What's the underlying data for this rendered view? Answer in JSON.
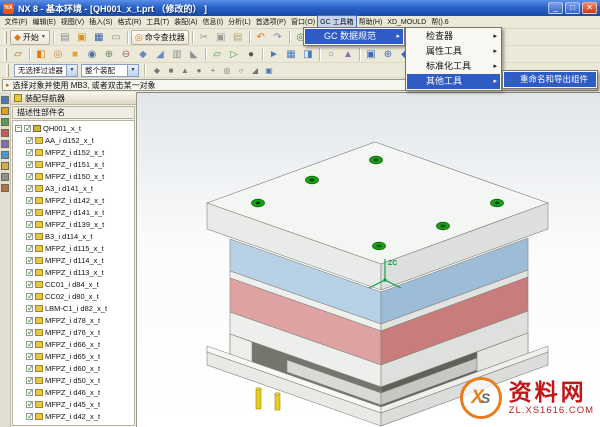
{
  "window": {
    "title": "NX 8 - 基本环境 - [QH001_x_t.prt （修改的） ]",
    "min": "_",
    "max": "□",
    "close": "✕"
  },
  "menubar": {
    "items": [
      {
        "name": "menu-file",
        "label": "文件(F)"
      },
      {
        "name": "menu-edit",
        "label": "编辑(E)"
      },
      {
        "name": "menu-view",
        "label": "视图(V)"
      },
      {
        "name": "menu-insert",
        "label": "插入(S)"
      },
      {
        "name": "menu-format",
        "label": "格式(R)"
      },
      {
        "name": "menu-tools",
        "label": "工具(T)"
      },
      {
        "name": "menu-assemblies",
        "label": "装配(A)"
      },
      {
        "name": "menu-information",
        "label": "信息(I)"
      },
      {
        "name": "menu-analysis",
        "label": "分析(L)"
      },
      {
        "name": "menu-preferences",
        "label": "首选项(P)"
      },
      {
        "name": "menu-window",
        "label": "窗口(O)"
      },
      {
        "name": "menu-gc-toolbox",
        "label": "GC 工具箱",
        "active": true
      },
      {
        "name": "menu-help",
        "label": "帮助(H)"
      },
      {
        "name": "menu-xd-mould",
        "label": "XD_MOULD"
      },
      {
        "name": "menu-help-2",
        "label": "帮().6"
      }
    ]
  },
  "toolbar1": {
    "start_label": "开始",
    "finder_label": "命令查找器",
    "items": [
      {
        "t": "handle"
      },
      {
        "t": "start"
      },
      {
        "t": "sep"
      },
      {
        "t": "icon",
        "name": "new-file-icon",
        "g": "▤",
        "c": "#8a8a8a"
      },
      {
        "t": "icon",
        "name": "open-folder-icon",
        "g": "▣",
        "c": "#d89020"
      },
      {
        "t": "icon",
        "name": "save-icon",
        "g": "▦",
        "c": "#3a5fa8"
      },
      {
        "t": "icon",
        "name": "print-icon",
        "g": "▭",
        "c": "#909090"
      },
      {
        "t": "sep"
      },
      {
        "t": "finder"
      },
      {
        "t": "sep"
      },
      {
        "t": "icon",
        "name": "cut-icon",
        "g": "✂",
        "c": "#9a9a9a"
      },
      {
        "t": "icon",
        "name": "copy-icon",
        "g": "▣",
        "c": "#9a9a9a"
      },
      {
        "t": "icon",
        "name": "paste-icon",
        "g": "▤",
        "c": "#b0a878"
      },
      {
        "t": "sep"
      },
      {
        "t": "icon",
        "name": "undo-icon",
        "g": "↶",
        "c": "#e07818"
      },
      {
        "t": "icon",
        "name": "redo-icon",
        "g": "↷",
        "c": "#7a8ab0"
      },
      {
        "t": "sep"
      },
      {
        "t": "icon",
        "name": "refresh-view-icon",
        "g": "◎",
        "c": "#4a8a4a"
      },
      {
        "t": "icon",
        "name": "fit-view-icon",
        "g": "▣",
        "c": "#4a7ac0"
      },
      {
        "t": "icon",
        "name": "orient-view-cube-icon",
        "g": "◧",
        "c": "#e07818"
      },
      {
        "t": "icon",
        "name": "shaded-view-icon",
        "g": "◨",
        "c": "#4a7ac0"
      },
      {
        "t": "icon",
        "name": "sphere-tool-icon",
        "g": "●",
        "c": "#b8c4d8"
      },
      {
        "t": "sep"
      },
      {
        "t": "icon",
        "name": "window-icon",
        "g": "▭",
        "c": "#5a7ab0"
      },
      {
        "t": "icon",
        "name": "pan-view-icon",
        "g": "+",
        "c": "#3a6ac0"
      },
      {
        "t": "icon",
        "name": "zoom-view-icon",
        "g": "○",
        "c": "#3a6ac0"
      },
      {
        "t": "icon",
        "name": "rotate-view-icon",
        "g": "◎",
        "c": "#3a6ac0"
      },
      {
        "t": "icon",
        "name": "front-view-icon",
        "g": "◇",
        "c": "#7a8a9a"
      },
      {
        "t": "icon",
        "name": "isometric-view-icon",
        "g": "◆",
        "c": "#7a8a9a"
      },
      {
        "t": "sep"
      },
      {
        "t": "icon",
        "name": "help-icon",
        "g": "?",
        "c": "#2a5ac8"
      }
    ]
  },
  "toolbar2": {
    "items": [
      {
        "t": "handle"
      },
      {
        "t": "icon",
        "name": "sketch-icon",
        "g": "▱",
        "c": "#b06820"
      },
      {
        "t": "sep"
      },
      {
        "t": "icon",
        "name": "extrude-icon",
        "g": "◧",
        "c": "#e07818"
      },
      {
        "t": "icon",
        "name": "revolve-icon",
        "g": "◎",
        "c": "#d08030"
      },
      {
        "t": "icon",
        "name": "block-icon",
        "g": "■",
        "c": "#e8a030"
      },
      {
        "t": "icon",
        "name": "hole-icon",
        "g": "◉",
        "c": "#4a6fa5"
      },
      {
        "t": "icon",
        "name": "unite-icon",
        "g": "⊕",
        "c": "#5a8a5a"
      },
      {
        "t": "icon",
        "name": "subtract-icon",
        "g": "⊖",
        "c": "#a05a5a"
      },
      {
        "t": "icon",
        "name": "edge-blend-icon",
        "g": "◆",
        "c": "#6a8ac0"
      },
      {
        "t": "icon",
        "name": "chamfer-icon",
        "g": "◢",
        "c": "#6a8ac0"
      },
      {
        "t": "icon",
        "name": "shell-icon",
        "g": "▥",
        "c": "#909090"
      },
      {
        "t": "icon",
        "name": "draft-icon",
        "g": "◣",
        "c": "#909090"
      },
      {
        "t": "sep"
      },
      {
        "t": "icon",
        "name": "datum-plane-icon",
        "g": "▱",
        "c": "#5a9a50"
      },
      {
        "t": "icon",
        "name": "datum-axis-icon",
        "g": "▷",
        "c": "#5a9a50"
      },
      {
        "t": "icon",
        "name": "point-icon",
        "g": "●",
        "c": "#555555"
      },
      {
        "t": "sep"
      },
      {
        "t": "icon",
        "name": "move-face-icon",
        "g": "►",
        "c": "#4a7ac0"
      },
      {
        "t": "icon",
        "name": "pattern-feature-icon",
        "g": "▦",
        "c": "#4a7ac0"
      },
      {
        "t": "icon",
        "name": "mirror-feature-icon",
        "g": "◨",
        "c": "#4a7ac0"
      },
      {
        "t": "sep"
      },
      {
        "t": "icon",
        "name": "measure-icon",
        "g": "○",
        "c": "#8a6ab0"
      },
      {
        "t": "icon",
        "name": "analysis-icon",
        "g": "▲",
        "c": "#8a6ab0"
      },
      {
        "t": "sep"
      },
      {
        "t": "icon",
        "name": "assembly-constraints-icon",
        "g": "▣",
        "c": "#3a6ac0"
      },
      {
        "t": "icon",
        "name": "add-component-icon",
        "g": "⊕",
        "c": "#3a6ac0"
      },
      {
        "t": "icon",
        "name": "move-component-icon",
        "g": "◆",
        "c": "#3a6ac0"
      },
      {
        "t": "icon",
        "name": "wave-link-icon",
        "g": "▨",
        "c": "#7a8a9a"
      },
      {
        "t": "icon",
        "name": "edit-section-icon",
        "g": "◩",
        "c": "#7a8a9a"
      },
      {
        "t": "sep"
      },
      {
        "t": "icon",
        "name": "layer-settings-icon",
        "g": "▤",
        "c": "#888888"
      },
      {
        "t": "icon",
        "name": "preferences-icon",
        "g": "▩",
        "c": "#888888"
      }
    ]
  },
  "selection_bar": {
    "filter_value": "无选择过滤器",
    "scope_value": "整个装配",
    "icons": [
      {
        "name": "snap-point-icon",
        "g": "◆",
        "c": "#777777"
      },
      {
        "name": "end-point-icon",
        "g": "■",
        "c": "#777777"
      },
      {
        "name": "mid-point-icon",
        "g": "▲",
        "c": "#777777"
      },
      {
        "name": "center-point-icon",
        "g": "●",
        "c": "#777777"
      },
      {
        "name": "intersection-point-icon",
        "g": "+",
        "c": "#777777"
      },
      {
        "name": "arc-center-icon",
        "g": "◎",
        "c": "#777777"
      },
      {
        "name": "existing-point-icon",
        "g": "○",
        "c": "#777777"
      },
      {
        "name": "tangent-point-icon",
        "g": "◢",
        "c": "#777777"
      },
      {
        "name": "snap-enabled-icon",
        "g": "▣",
        "c": "#4a7ac0"
      }
    ]
  },
  "prompt": {
    "text": "选择对象并使用 MB3, 或者双击某一对象"
  },
  "menus": {
    "gc_toolbox": {
      "items": [
        {
          "name": "menu-item-gc-data-standard",
          "label": "GC 数据规范",
          "hl": true,
          "sub": true
        }
      ]
    },
    "data_standard": {
      "items": [
        {
          "name": "menu-item-checker",
          "label": "检查器",
          "sub": true
        },
        {
          "name": "menu-item-attribute-tools",
          "label": "属性工具",
          "sub": true
        },
        {
          "name": "menu-item-standardization-tools",
          "label": "标准化工具",
          "sub": true
        },
        {
          "name": "menu-item-other-tools",
          "label": "其他工具",
          "hl": true,
          "sub": true
        }
      ]
    },
    "other_tools": {
      "items": [
        {
          "name": "menu-item-rename-export-components",
          "label": "重命名和导出组件",
          "hl": true,
          "icon": "rename-export-icon",
          "icon_glyph": "▤"
        }
      ]
    }
  },
  "navigator": {
    "title": "装配导航器",
    "column_header": "描述性部件名",
    "root_label": "QH001_x_t",
    "items": [
      "AA_i d152_x_t",
      "MFPZ_i d152_x_t",
      "MFPZ_i d151_x_t",
      "MFPZ_i d150_x_t",
      "A3_i d141_x_t",
      "MFPZ_i d142_x_t",
      "MFPZ_i d141_x_t",
      "MFPZ_i d139_x_t",
      "B3_i d114_x_t",
      "MFPZ_i d115_x_t",
      "MFPZ_i d114_x_t",
      "MFPZ_i d113_x_t",
      "CC01_i d84_x_t",
      "CC02_i d80_x_t",
      "LBM-C1_i d82_x_t",
      "MFPZ_i d78_x_t",
      "MFPZ_i d76_x_t",
      "MFPZ_i d66_x_t",
      "MFPZ_i d65_x_t",
      "MFPZ_i d60_x_t",
      "MFPZ_i d50_x_t",
      "MFPZ_i d46_x_t",
      "MFPZ_i d45_x_t",
      "MFPZ_i d42_x_t"
    ]
  },
  "resource_bar": {
    "icons": [
      {
        "name": "assembly-navigator-tab-icon",
        "c": "#4a78c0"
      },
      {
        "name": "constraint-navigator-tab-icon",
        "c": "#e0a020"
      },
      {
        "name": "part-navigator-tab-icon",
        "c": "#5a9a50"
      },
      {
        "name": "reuse-library-tab-icon",
        "c": "#c05a5a"
      },
      {
        "name": "hd3d-tool-tab-icon",
        "c": "#8868b0"
      },
      {
        "name": "internet-explorer-tab-icon",
        "c": "#4a9ad0"
      },
      {
        "name": "history-tab-icon",
        "c": "#d0b040"
      },
      {
        "name": "system-materials-tab-icon",
        "c": "#909090"
      },
      {
        "name": "roles-tab-icon",
        "c": "#b07040"
      }
    ]
  },
  "viewport": {
    "axis_label": "ZC",
    "colors": {
      "top_plate": "#f4f6f4",
      "a_plate_blue": "#b7d1e6",
      "b_plate_red": "#dfa2a2",
      "screw_green": "#17a017",
      "pin_yellow": "#e5ce1c"
    }
  },
  "watermark": {
    "logo_x": "X",
    "logo_s": "S",
    "site": "资料网",
    "url": "ZL.XS1616.COM"
  }
}
